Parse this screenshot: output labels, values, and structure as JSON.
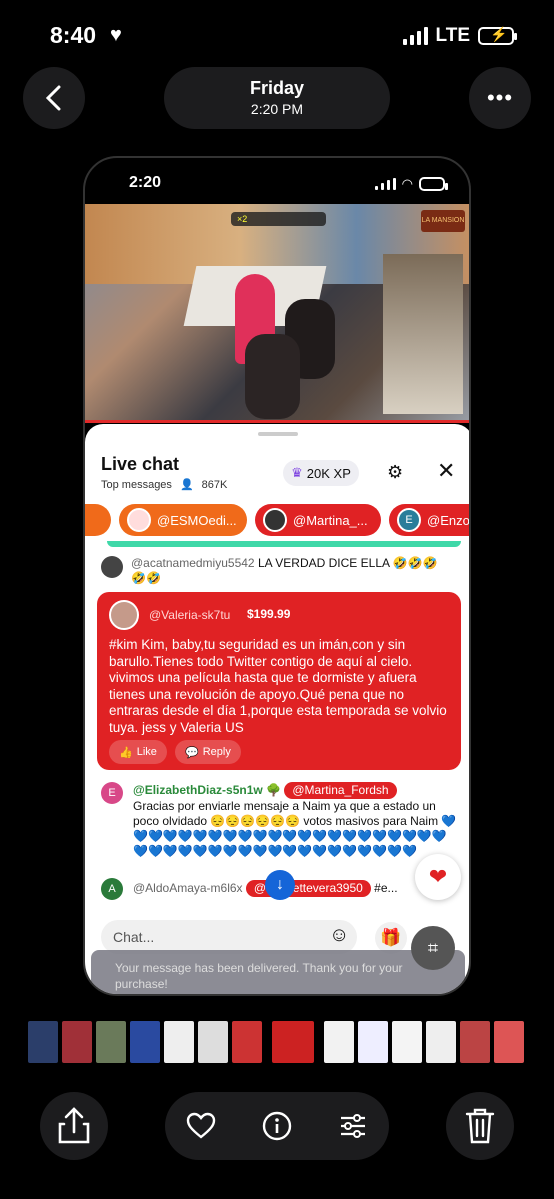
{
  "status_bar": {
    "time": "8:40",
    "network": "LTE"
  },
  "header": {
    "day": "Friday",
    "time": "2:20 PM"
  },
  "inner_phone": {
    "time": "2:20"
  },
  "video": {
    "counter_text": "×2",
    "logo_text": "LA MANSION"
  },
  "live_chat": {
    "title": "Live chat",
    "subtitle": "Top messages",
    "viewers": "867K",
    "xp": "20K XP",
    "chips": [
      {
        "label": "@ESMOedi..."
      },
      {
        "label": "@Martina_..."
      },
      {
        "label": "@EnzojR"
      }
    ],
    "messages": [
      {
        "user": "@acatnamedmiyu5542",
        "text": "LA VERDAD DICE ELLA 🤣🤣🤣🤣🤣"
      },
      {
        "user": "@ElizabethDiaz-s5n1w 🌳",
        "mention": "@Martina_Fordsh",
        "text": "Gracias por enviarle mensaje a Naim ya que a estado un poco olvidado 😔😔😔😔😔😔 votos masivos para Naim 💙💙💙💙💙💙💙💙💙💙💙💙💙💙💙💙💙💙💙💙💙💙💙💙💙💙💙💙💙💙💙💙💙💙💙💙💙💙💙💙💙"
      },
      {
        "user": "@AldoAmaya-m6l6x",
        "mention": "@henriettevera3950",
        "text": "#e..."
      }
    ],
    "superchat": {
      "user": "@Valeria-sk7tu",
      "amount": "$199.99",
      "text": "#kim Kim, baby,tu seguridad es un imán,con y sin barullo.Tienes todo Twitter contigo de aquí al cielo. vivimos una película hasta que te dormiste y afuera tienes una revolución de apoyo.Qué pena que no entraras desde el día 1,porque esta temporada se volvio tuya. jess y Valeria US",
      "like": "Like",
      "reply": "Reply"
    },
    "chat_placeholder": "Chat...",
    "toast": "Your message has been delivered. Thank you for your purchase!"
  },
  "colors": {
    "accent": "#e02224",
    "chip_orange": "#f06a1a",
    "blue": "#1565d8"
  }
}
